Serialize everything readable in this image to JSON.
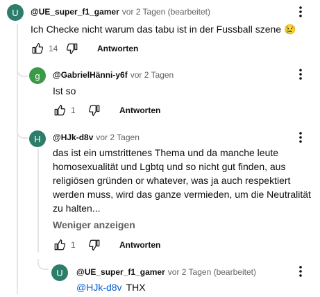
{
  "comments": [
    {
      "author": "@UE_super_f1_gamer",
      "meta": "vor 2 Tagen (bearbeitet)",
      "text": "Ich Checke nicht warum das tabu ist in der Fussball szene 😢",
      "likes": "14",
      "reply_label": "Antworten",
      "avatar_letter": "U",
      "avatar_color": "#2e7d6b"
    },
    {
      "author": "@GabrielHänni-y6f",
      "meta": "vor 2 Tagen",
      "text": "Ist so",
      "likes": "1",
      "reply_label": "Antworten",
      "avatar_letter": "g",
      "avatar_color": "#3a9a45"
    },
    {
      "author": "@HJk-d8v",
      "meta": "vor 2 Tagen",
      "text": "das ist ein umstrittenes Thema und da manche leute homosexualität und Lgbtq und so nicht gut finden, aus religiösen gründen or whatever, was ja auch respektiert werden muss, wird das ganze vermieden, um die Neutralität zu halten...",
      "show_less": "Weniger anzeigen",
      "likes": "1",
      "reply_label": "Antworten",
      "avatar_letter": "H",
      "avatar_color": "#2e7d6b"
    },
    {
      "author": "@UE_super_f1_gamer",
      "meta": "vor 2 Tagen (bearbeitet)",
      "mention": "@HJk-d8v",
      "text": "THX",
      "avatar_letter": "U",
      "avatar_color": "#2e7d6b"
    }
  ]
}
